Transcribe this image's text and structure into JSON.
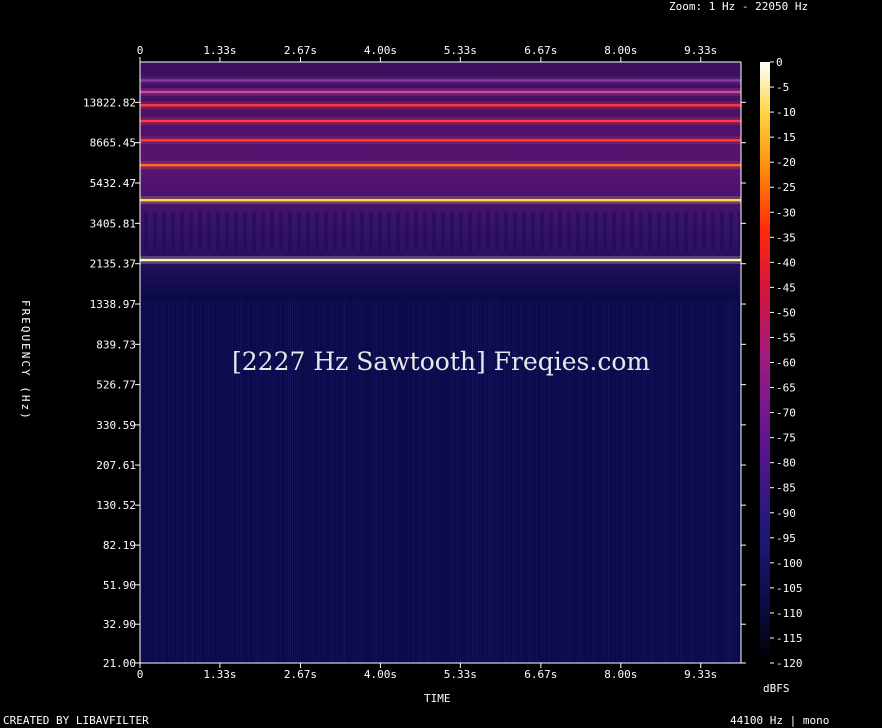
{
  "header": {
    "zoom_text": "Zoom: 1 Hz - 22050 Hz"
  },
  "footer": {
    "created_by": "CREATED BY LIBAVFILTER",
    "sample_info": "44100 Hz | mono"
  },
  "overlay": {
    "watermark": "[2227 Hz Sawtooth] Freqies.com"
  },
  "colors": {
    "background": "#000000",
    "plot_base": "#0a0a45",
    "axis": "#ffffff"
  },
  "chart_data": {
    "type": "heatmap",
    "xlabel": "TIME",
    "ylabel": "FREQUENCY (Hz)",
    "colorbar_label": "dBFS",
    "x_ticks": [
      "0",
      "1.33s",
      "2.67s",
      "4.00s",
      "5.33s",
      "6.67s",
      "8.00s",
      "9.33s"
    ],
    "x_tick_values": [
      0,
      1.33,
      2.67,
      4.0,
      5.33,
      6.67,
      8.0,
      9.33
    ],
    "xlim": [
      0,
      10
    ],
    "y_scale": "log",
    "y_ticks": [
      "21.00",
      "32.90",
      "51.90",
      "82.19",
      "130.52",
      "207.61",
      "330.59",
      "526.77",
      "839.73",
      "1338.97",
      "2135.37",
      "3405.81",
      "5432.47",
      "8665.45",
      "13822.82"
    ],
    "y_tick_values": [
      21.0,
      32.9,
      51.9,
      82.19,
      130.52,
      207.61,
      330.59,
      526.77,
      839.73,
      1338.97,
      2135.37,
      3405.81,
      5432.47,
      8665.45,
      13822.82
    ],
    "ylim": [
      21,
      22050
    ],
    "colorbar_ticks": [
      "0",
      "-5",
      "-10",
      "-15",
      "-20",
      "-25",
      "-30",
      "-35",
      "-40",
      "-45",
      "-50",
      "-55",
      "-60",
      "-65",
      "-70",
      "-75",
      "-80",
      "-85",
      "-90",
      "-95",
      "-100",
      "-105",
      "-110",
      "-115",
      "-120"
    ],
    "colorbar_range": [
      -120,
      0
    ],
    "harmonics": [
      {
        "freq_hz": 2227,
        "level_dbfs": -5
      },
      {
        "freq_hz": 4454,
        "level_dbfs": -10
      },
      {
        "freq_hz": 6681,
        "level_dbfs": -30
      },
      {
        "freq_hz": 8908,
        "level_dbfs": -35
      },
      {
        "freq_hz": 11135,
        "level_dbfs": -45
      },
      {
        "freq_hz": 13362,
        "level_dbfs": -40
      },
      {
        "freq_hz": 15589,
        "level_dbfs": -60
      },
      {
        "freq_hz": 17816,
        "level_dbfs": -75
      }
    ]
  }
}
